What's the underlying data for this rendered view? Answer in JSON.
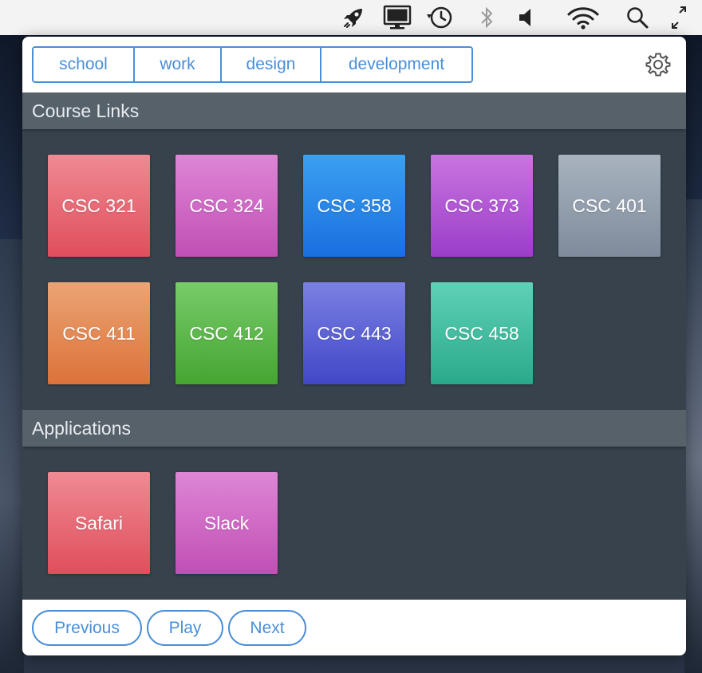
{
  "menubar": {
    "icons": [
      "rocket-icon",
      "display-icon",
      "time-machine-icon",
      "bluetooth-icon",
      "volume-icon",
      "wifi-icon",
      "spotlight-search-icon",
      "fullscreen-icon"
    ]
  },
  "tabs": [
    {
      "label": "school"
    },
    {
      "label": "work"
    },
    {
      "label": "design"
    },
    {
      "label": "development"
    }
  ],
  "settings_icon": "gear-icon",
  "sections": {
    "course_links": {
      "title": "Course Links",
      "tiles": [
        {
          "label": "CSC 321",
          "color_top": "#ef8a93",
          "color_bottom": "#e04e5c"
        },
        {
          "label": "CSC 324",
          "color_top": "#de86d6",
          "color_bottom": "#c14fb5"
        },
        {
          "label": "CSC 358",
          "color_top": "#3aa0ef",
          "color_bottom": "#1a6fe0"
        },
        {
          "label": "CSC 373",
          "color_top": "#c974e0",
          "color_bottom": "#9a3ec9"
        },
        {
          "label": "CSC 401",
          "color_top": "#a9b3bf",
          "color_bottom": "#7f8b9c"
        },
        {
          "label": "CSC 411",
          "color_top": "#eba474",
          "color_bottom": "#dc723a"
        },
        {
          "label": "CSC 412",
          "color_top": "#78cc6a",
          "color_bottom": "#45a531"
        },
        {
          "label": "CSC 443",
          "color_top": "#7b80e2",
          "color_bottom": "#4048c6"
        },
        {
          "label": "CSC 458",
          "color_top": "#5fd1b6",
          "color_bottom": "#2aa98a"
        }
      ]
    },
    "applications": {
      "title": "Applications",
      "tiles": [
        {
          "label": "Safari",
          "color_top": "#ef8a93",
          "color_bottom": "#e04e5c"
        },
        {
          "label": "Slack",
          "color_top": "#de86d6",
          "color_bottom": "#c14fb5"
        }
      ]
    }
  },
  "footer": {
    "previous_label": "Previous",
    "play_label": "Play",
    "next_label": "Next"
  },
  "colors": {
    "accent": "#4a8ed8",
    "panel": "#37424c",
    "section_header": "#56616a"
  }
}
